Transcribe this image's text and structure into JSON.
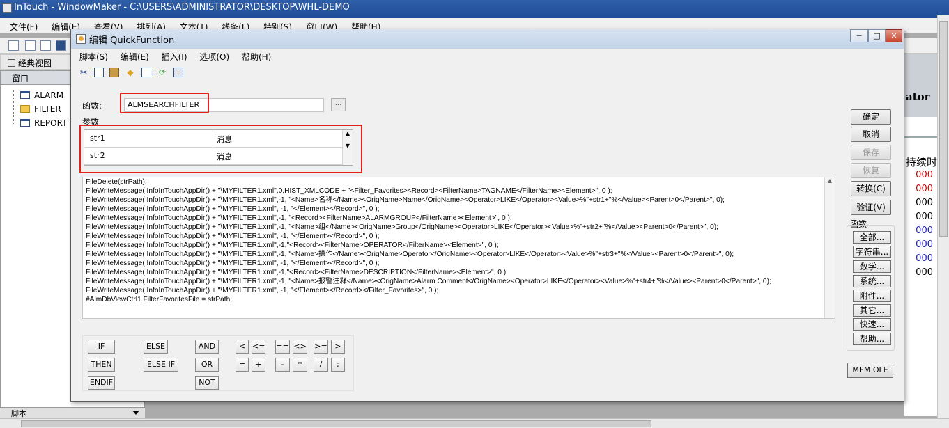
{
  "app": {
    "title": "InTouch - WindowMaker - C:\\USERS\\ADMINISTRATOR\\DESKTOP\\WHL-DEMO",
    "menu": [
      "文件(F)",
      "编辑(E)",
      "查看(V)",
      "排列(A)",
      "文本(T)",
      "线条(L)",
      "特别(S)",
      "窗口(W)",
      "帮助(H)"
    ]
  },
  "left_panel": {
    "classic_view": "经典视图",
    "header": "窗口",
    "items": [
      "ALARM",
      "FILTER",
      "REPORT"
    ],
    "bottom_tab": "脚本"
  },
  "background": {
    "title_fragment": "ator",
    "duration_header": "持续时",
    "rows": [
      {
        "text": "000",
        "color": "#cc0000"
      },
      {
        "text": "000",
        "color": "#cc0000"
      },
      {
        "text": "000",
        "color": "#000000"
      },
      {
        "text": "000",
        "color": "#000000"
      },
      {
        "text": "000",
        "color": "#1f1fbf"
      },
      {
        "text": "000",
        "color": "#1f1fbf"
      },
      {
        "text": "000",
        "color": "#1f1fbf"
      },
      {
        "text": "000",
        "color": "#000000"
      }
    ]
  },
  "dialog": {
    "title": "编辑 QuickFunction",
    "menu": [
      "脚本(S)",
      "编辑(E)",
      "插入(I)",
      "选项(O)",
      "帮助(H)"
    ],
    "toolbar_icons": [
      "cut-icon",
      "copy-icon",
      "paste-icon",
      "tag-icon",
      "window-icon",
      "refresh-icon",
      "print-icon"
    ],
    "function_label": "函数:",
    "function_name": "ALMSEARCHFILTER",
    "ellipsis": "...",
    "params_label": "参数",
    "params": [
      {
        "name": "str1",
        "type": "消息"
      },
      {
        "name": "str2",
        "type": "消息"
      }
    ],
    "code": "FileDelete(strPath);\nFileWriteMessage( InfoInTouchAppDir() + \"\\MYFILTER1.xml\",0,HIST_XMLCODE + \"<Filter_Favorites><Record><FilterName>TAGNAME</FilterName><Element>\", 0 );\nFileWriteMessage( InfoInTouchAppDir() + \"\\MYFILTER1.xml\",-1, \"<Name>名称</Name><OrigName>Name</OrigName><Operator>LIKE</Operator><Value>%\"+str1+\"%</Value><Parent>0</Parent>\", 0);\nFileWriteMessage( InfoInTouchAppDir() + \"\\MYFILTER1.xml\", -1, \"</Element></Record>\", 0 );\nFileWriteMessage( InfoInTouchAppDir() + \"\\MYFILTER1.xml\",-1, \"<Record><FilterName>ALARMGROUP</FilterName><Element>\", 0 );\nFileWriteMessage( InfoInTouchAppDir() + \"\\MYFILTER1.xml\",-1, \"<Name>组</Name><OrigName>Group</OrigName><Operator>LIKE</Operator><Value>%\"+str2+\"%</Value><Parent>0</Parent>\", 0);\nFileWriteMessage( InfoInTouchAppDir() + \"\\MYFILTER1.xml\", -1, \"</Element></Record>\", 0 );\nFileWriteMessage( InfoInTouchAppDir() + \"\\MYFILTER1.xml\",-1,\"<Record><FilterName>OPERATOR</FilterName><Element>\", 0 );\nFileWriteMessage( InfoInTouchAppDir() + \"\\MYFILTER1.xml\",-1, \"<Name>操作</Name><OrigName>Operator</OrigName><Operator>LIKE</Operator><Value>%\"+str3+\"%</Value><Parent>0</Parent>\", 0);\nFileWriteMessage( InfoInTouchAppDir() + \"\\MYFILTER1.xml\", -1, \"</Element></Record>\", 0 );\nFileWriteMessage( InfoInTouchAppDir() + \"\\MYFILTER1.xml\",-1,\"<Record><FilterName>DESCRIPTION</FilterName><Element>\", 0 );\nFileWriteMessage( InfoInTouchAppDir() + \"\\MYFILTER1.xml\",-1, \"<Name>报警注释</Name><OrigName>Alarm Comment</OrigName><Operator>LIKE</Operator><Value>%\"+str4+\"%</Value><Parent>0</Parent>\", 0);\nFileWriteMessage( InfoInTouchAppDir() + \"\\MYFILTER1.xml\", -1, \"</Element></Record></Filter_Favorites>\", 0 );\n#AlmDbViewCtrl1.FilterFavoritesFile = strPath;",
    "buttons": {
      "ok": "确定",
      "cancel": "取消",
      "save": "保存",
      "restore": "恢复",
      "convert": "转换(C)",
      "validate": "验证(V)",
      "mem_ole": "MEM OLE"
    },
    "functions_label": "函数",
    "function_buttons": [
      "全部...",
      "字符串...",
      "数学...",
      "系统...",
      "附件...",
      "其它...",
      "快速...",
      "帮助..."
    ],
    "keypad": {
      "if": "IF",
      "then": "THEN",
      "endif": "ENDIF",
      "else": "ELSE",
      "else_if": "ELSE IF",
      "and": "AND",
      "or": "OR",
      "not": "NOT",
      "lt": "<",
      "le": "<=",
      "eq": "==",
      "ne": "<>",
      "ge": ">=",
      "gt": ">",
      "assign": "=",
      "plus": "+",
      "minus": "-",
      "mult": "*",
      "div": "/",
      "semi": ";"
    }
  }
}
